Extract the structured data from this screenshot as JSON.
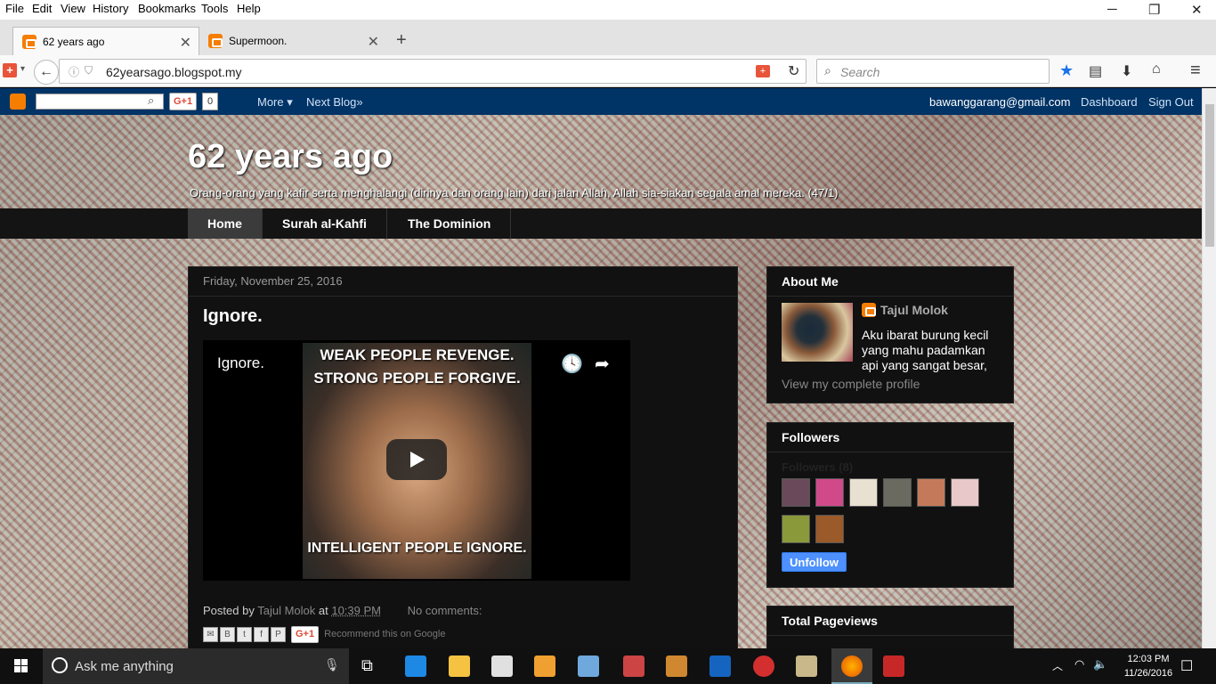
{
  "menubar": {
    "items": [
      "File",
      "Edit",
      "View",
      "History",
      "Bookmarks",
      "Tools",
      "Help"
    ]
  },
  "tabs": [
    {
      "title": "62 years ago",
      "active": true,
      "icon": "blogger-icon"
    },
    {
      "title": "Supermoon.",
      "active": false,
      "icon": "blogger-icon"
    }
  ],
  "navbar": {
    "url": "62yearsago.blogspot.my",
    "search_placeholder": "Search"
  },
  "bloggerbar": {
    "gplus_label": "G+1",
    "gplus_count": "0",
    "more_label": "More ▾",
    "next_blog_label": "Next Blog»",
    "email": "bawanggarang@gmail.com",
    "dashboard_label": "Dashboard",
    "signout_label": "Sign Out"
  },
  "blog": {
    "title": "62 years ago",
    "description": "Orang-orang yang kafir serta menghalangi (dirinya dan orang lain) dari jalan Allah, Allah sia-siakan segala amal mereka. (47/1)"
  },
  "pagetabs": [
    "Home",
    "Surah al-Kahfi",
    "The Dominion"
  ],
  "post": {
    "date": "Friday, November 25, 2016",
    "title": "Ignore.",
    "video_title": "Ignore.",
    "thumb_top_line1": "WEAK PEOPLE REVENGE.",
    "thumb_top_line2": "STRONG PEOPLE FORGIVE.",
    "thumb_bottom": "INTELLIGENT PEOPLE IGNORE.",
    "posted_by_label": "Posted by",
    "author": "Tajul Molok",
    "at_label": "at",
    "time": "10:39 PM",
    "comments": "No comments:",
    "share_gplus": "G+1",
    "recommend": "Recommend this on Google"
  },
  "about": {
    "title": "About Me",
    "name": "Tajul Molok",
    "description": "Aku ibarat burung kecil yang mahu padamkan api yang sangat besar,",
    "profile_link": "View my complete profile"
  },
  "followers": {
    "title": "Followers",
    "count_label": "Followers (8)",
    "unfollow_label": "Unfollow",
    "thumb_colors": [
      "#6a4a5a",
      "#d04a8a",
      "#e8e0d0",
      "#6a6a60",
      "#c47a5a",
      "#e8c8c8",
      "#8a9a3a",
      "#9a5a2a"
    ]
  },
  "pageviews": {
    "title": "Total Pageviews"
  },
  "taskbar": {
    "cortana_text": "Ask me anything",
    "time": "12:03 PM",
    "date": "11/26/2016"
  }
}
